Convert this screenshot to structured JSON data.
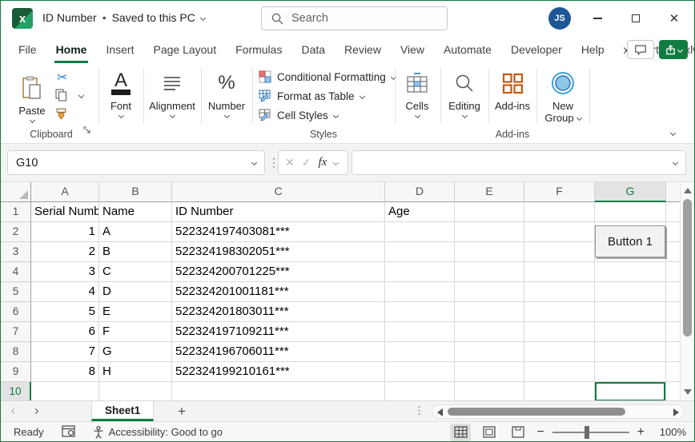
{
  "colors": {
    "excel_green": "#107C41",
    "avatar_blue": "#1d5796",
    "addins_orange": "#c55a11"
  },
  "title_bar": {
    "document_title": "ID Number",
    "separator": "•",
    "save_status": "Saved to this PC",
    "search_placeholder": "Search",
    "avatar_initials": "JS"
  },
  "ribbon": {
    "tabs": [
      "File",
      "Home",
      "Insert",
      "Page Layout",
      "Formulas",
      "Data",
      "Review",
      "View",
      "Automate",
      "Developer",
      "Help",
      "xlChart+",
      "xlwings"
    ],
    "active_tab": "Home",
    "groups": {
      "clipboard": {
        "label": "Clipboard",
        "paste_label": "Paste"
      },
      "font": {
        "label": "Font"
      },
      "alignment": {
        "label": "Alignment"
      },
      "number": {
        "label": "Number"
      },
      "styles": {
        "label": "Styles",
        "items": [
          "Conditional Formatting",
          "Format as Table",
          "Cell Styles"
        ]
      },
      "cells": {
        "label": "Cells"
      },
      "editing": {
        "label": "Editing"
      },
      "addins": {
        "button_label": "Add-ins",
        "label": "Add-ins"
      },
      "new_group": {
        "line1": "New",
        "line2": "Group"
      }
    }
  },
  "formula_bar": {
    "name_box": "G10",
    "fx_label": "fx",
    "formula_value": ""
  },
  "sheet": {
    "columns": [
      "A",
      "B",
      "C",
      "D",
      "E",
      "F",
      "G"
    ],
    "selected_column": "G",
    "selected_row": 10,
    "selected_cell": "G10",
    "button_label": "Button 1",
    "rows": [
      {
        "n": 1,
        "A": "Serial Number",
        "B": "Name",
        "C": "ID Number",
        "D": "Age"
      },
      {
        "n": 2,
        "A": "1",
        "B": "A",
        "C": "522324197403081***"
      },
      {
        "n": 3,
        "A": "2",
        "B": "B",
        "C": "522324198302051***"
      },
      {
        "n": 4,
        "A": "3",
        "B": "C",
        "C": "522324200701225***"
      },
      {
        "n": 5,
        "A": "4",
        "B": "D",
        "C": "522324201001181***"
      },
      {
        "n": 6,
        "A": "5",
        "B": "E",
        "C": "522324201803011***"
      },
      {
        "n": 7,
        "A": "6",
        "B": "F",
        "C": "522324197109211***"
      },
      {
        "n": 8,
        "A": "7",
        "B": "G",
        "C": "522324196706011***"
      },
      {
        "n": 9,
        "A": "8",
        "B": "H",
        "C": "522324199210161***"
      },
      {
        "n": 10
      }
    ]
  },
  "tab_bar": {
    "active_sheet": "Sheet1"
  },
  "status_bar": {
    "mode": "Ready",
    "accessibility": "Accessibility: Good to go",
    "zoom_level": "100%"
  }
}
